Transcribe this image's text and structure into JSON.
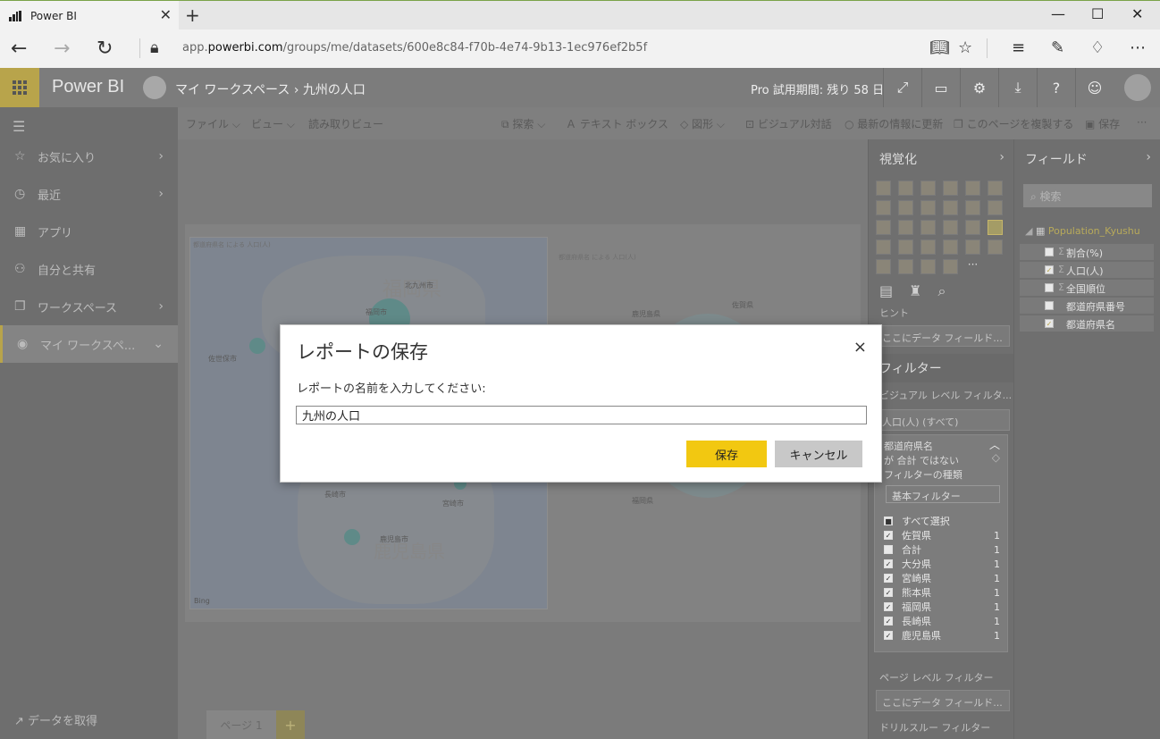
{
  "browser": {
    "tab_title": "Power BI",
    "url_prefix": "app.",
    "url_domain": "powerbi.com",
    "url_path": "/groups/me/datasets/600e8c84-f70b-4e74-9b13-1ec976ef2b5f"
  },
  "app": {
    "brand": "Power BI",
    "breadcrumb_workspace": "マイ ワークスペース",
    "breadcrumb_sep": "›",
    "breadcrumb_item": "九州の人口",
    "trial": "Pro 試用期間: 残り 58 日"
  },
  "leftnav": {
    "items": [
      {
        "label": "お気に入り"
      },
      {
        "label": "最近"
      },
      {
        "label": "アプリ"
      },
      {
        "label": "自分と共有"
      },
      {
        "label": "ワークスペース"
      },
      {
        "label": "マイ ワークスペ..."
      }
    ],
    "get_data": "データを取得"
  },
  "toolbar": {
    "file": "ファイル ⌵",
    "view": "ビュー ⌵",
    "reading_view": "読み取りビュー",
    "explore": "探索 ⌵",
    "textbox": "テキスト ボックス",
    "shapes": "図形 ⌵",
    "visual_interactions": "ビジュアル対話",
    "refresh": "最新の情報に更新",
    "duplicate": "このページを複製する",
    "save": "保存",
    "more": "···"
  },
  "canvas": {
    "map_title": "都道府県名 による 人口(人)",
    "pie_title": "都道府県名 による 人口(人)",
    "map_prefecture_labels": [
      "福岡県",
      "鹿児島県"
    ],
    "map_cities": [
      "福岡市",
      "佐世保市",
      "長崎市",
      "宮崎市",
      "鹿児島市",
      "北九州市"
    ],
    "map_bing": "Bing",
    "pie_labels": [
      "鹿児島県",
      "佐賀県",
      "福岡県"
    ],
    "page_tab": "ページ 1",
    "add_page": "+"
  },
  "viz_pane": {
    "title": "視覚化",
    "hint": "ヒント",
    "data_well": "ここにデータ フィールド...",
    "filters_title": "フィルター",
    "visual_level": "ビジュアル レベル フィルタ...",
    "filter_value": "人口(人) (すべて)",
    "filter_card_lines": [
      "都道府県名",
      "が 合計 ではない",
      "フィルターの種類"
    ],
    "filter_type": "基本フィルター",
    "filter_rows": [
      {
        "label": "すべて選択",
        "count": "",
        "checked": "partial"
      },
      {
        "label": "佐賀県",
        "count": "1",
        "checked": "yes"
      },
      {
        "label": "合計",
        "count": "1",
        "checked": "no"
      },
      {
        "label": "大分県",
        "count": "1",
        "checked": "yes"
      },
      {
        "label": "宮崎県",
        "count": "1",
        "checked": "yes"
      },
      {
        "label": "熊本県",
        "count": "1",
        "checked": "yes"
      },
      {
        "label": "福岡県",
        "count": "1",
        "checked": "yes"
      },
      {
        "label": "長崎県",
        "count": "1",
        "checked": "yes"
      },
      {
        "label": "鹿児島県",
        "count": "1",
        "checked": "yes"
      }
    ],
    "page_level": "ページ レベル フィルター",
    "page_well": "ここにデータ フィールド...",
    "drill": "ドリルスルー フィルター"
  },
  "fields_pane": {
    "title": "フィールド",
    "search_placeholder": "検索",
    "table": "Population_Kyushu",
    "fields": [
      {
        "label": "割合(%)",
        "sigma": "Σ",
        "checked": false
      },
      {
        "label": "人口(人)",
        "sigma": "Σ",
        "checked": true
      },
      {
        "label": "全国順位",
        "sigma": "Σ",
        "checked": false
      },
      {
        "label": "都道府県番号",
        "sigma": "",
        "checked": false
      },
      {
        "label": "都道府県名",
        "sigma": "",
        "checked": true
      }
    ]
  },
  "modal": {
    "title": "レポートの保存",
    "label": "レポートの名前を入力してください:",
    "input_value": "九州の人口",
    "save": "保存",
    "cancel": "キャンセル",
    "close": "×"
  },
  "colors": {
    "accent": "#f2c811",
    "header_bg": "#7c7c7c"
  }
}
